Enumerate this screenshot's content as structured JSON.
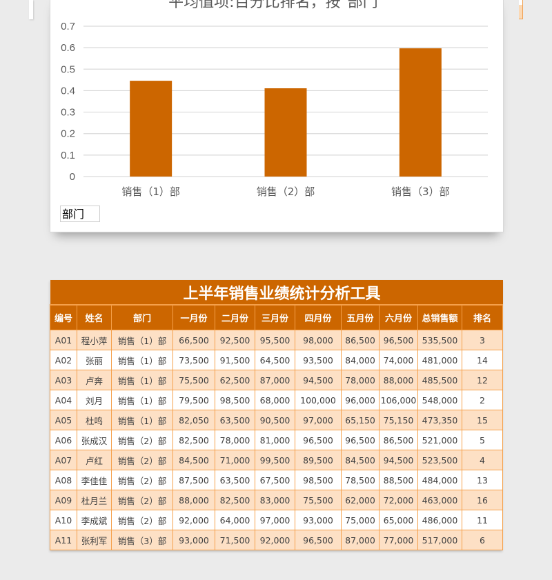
{
  "chart_data": {
    "type": "bar",
    "title": "平均值项:百分比排名，按\"部门\"",
    "categories": [
      "销售（1）部",
      "销售（2）部",
      "销售（3）部"
    ],
    "values": [
      0.446,
      0.411,
      0.597
    ],
    "ylim": [
      0,
      0.7
    ],
    "yticks": [
      "0",
      "0.1",
      "0.2",
      "0.3",
      "0.4",
      "0.5",
      "0.6",
      "0.7"
    ],
    "xlabel": "",
    "ylabel": "",
    "grid": true,
    "bar_color": "#cc6600"
  },
  "chart_panel": {
    "field_button_label": "部门"
  },
  "table": {
    "title": "上半年销售业绩统计分析工具",
    "columns": [
      "编号",
      "姓名",
      "部门",
      "一月份",
      "二月份",
      "三月份",
      "四月份",
      "五月份",
      "六月份",
      "总销售额",
      "排名"
    ],
    "rows": [
      [
        "A01",
        "程小萍",
        "销售（1）部",
        "66,500",
        "92,500",
        "95,500",
        "98,000",
        "86,500",
        "96,500",
        "535,500",
        "3"
      ],
      [
        "A02",
        "张丽",
        "销售（1）部",
        "73,500",
        "91,500",
        "64,500",
        "93,500",
        "84,000",
        "74,000",
        "481,000",
        "14"
      ],
      [
        "A03",
        "卢奔",
        "销售（1）部",
        "75,500",
        "62,500",
        "87,000",
        "94,500",
        "78,000",
        "88,000",
        "485,500",
        "12"
      ],
      [
        "A04",
        "刘月",
        "销售（1）部",
        "79,500",
        "98,500",
        "68,000",
        "100,000",
        "96,000",
        "106,000",
        "548,000",
        "2"
      ],
      [
        "A05",
        "杜鸣",
        "销售（1）部",
        "82,050",
        "63,500",
        "90,500",
        "97,000",
        "65,150",
        "75,150",
        "473,350",
        "15"
      ],
      [
        "A06",
        "张成汉",
        "销售（2）部",
        "82,500",
        "78,000",
        "81,000",
        "96,500",
        "96,500",
        "86,500",
        "521,000",
        "5"
      ],
      [
        "A07",
        "卢红",
        "销售（2）部",
        "84,500",
        "71,000",
        "99,500",
        "89,500",
        "84,500",
        "94,500",
        "523,500",
        "4"
      ],
      [
        "A08",
        "李佳佳",
        "销售（2）部",
        "87,500",
        "63,500",
        "67,500",
        "98,500",
        "78,500",
        "88,500",
        "484,000",
        "13"
      ],
      [
        "A09",
        "杜月兰",
        "销售（2）部",
        "88,000",
        "82,500",
        "83,000",
        "75,500",
        "62,000",
        "72,000",
        "463,000",
        "16"
      ],
      [
        "A10",
        "李成斌",
        "销售（2）部",
        "92,000",
        "64,000",
        "97,000",
        "93,000",
        "75,000",
        "65,000",
        "486,000",
        "11"
      ],
      [
        "A11",
        "张利军",
        "销售（3）部",
        "93,000",
        "71,500",
        "92,000",
        "96,500",
        "87,000",
        "77,000",
        "517,000",
        "6"
      ]
    ]
  },
  "colors": {
    "header_bg": "#cc6600",
    "row_alt_bg": "#fde0c5",
    "border": "#f5a04a"
  }
}
